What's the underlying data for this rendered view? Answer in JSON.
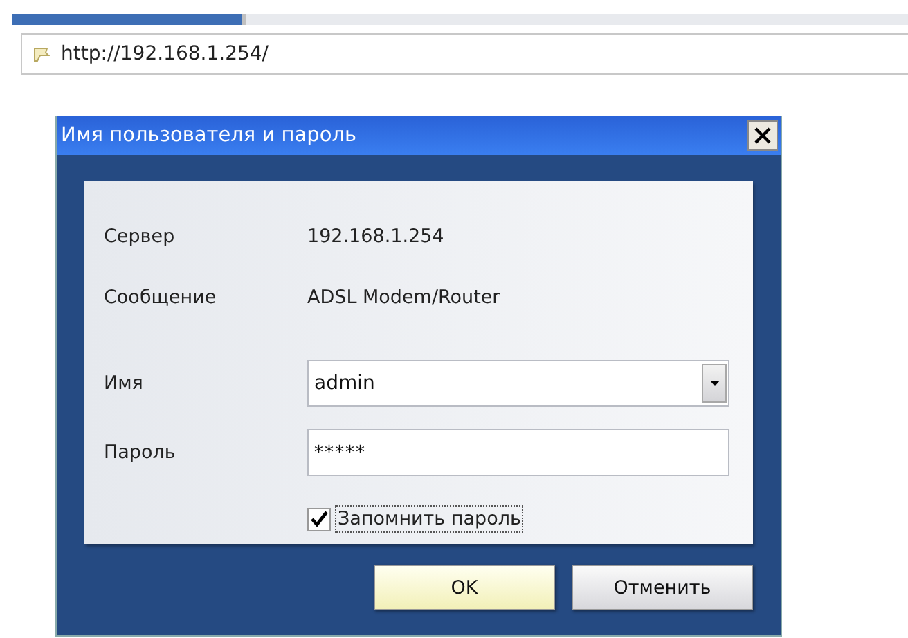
{
  "browser": {
    "address": "http://192.168.1.254/"
  },
  "dialog": {
    "title": "Имя пользователя и пароль",
    "info": [
      {
        "label": "Сервер",
        "value": "192.168.1.254"
      },
      {
        "label": "Сообщение",
        "value": "ADSL Modem/Router"
      }
    ],
    "fields": [
      {
        "kind": "combo",
        "label": "Имя",
        "value": "admin"
      },
      {
        "kind": "password",
        "label": "Пароль",
        "value": "*****"
      }
    ],
    "remember": {
      "label": "Запомнить пароль",
      "checked": true
    },
    "buttons": [
      {
        "label": "OK",
        "default": true
      },
      {
        "label": "Отменить",
        "default": false
      }
    ]
  }
}
